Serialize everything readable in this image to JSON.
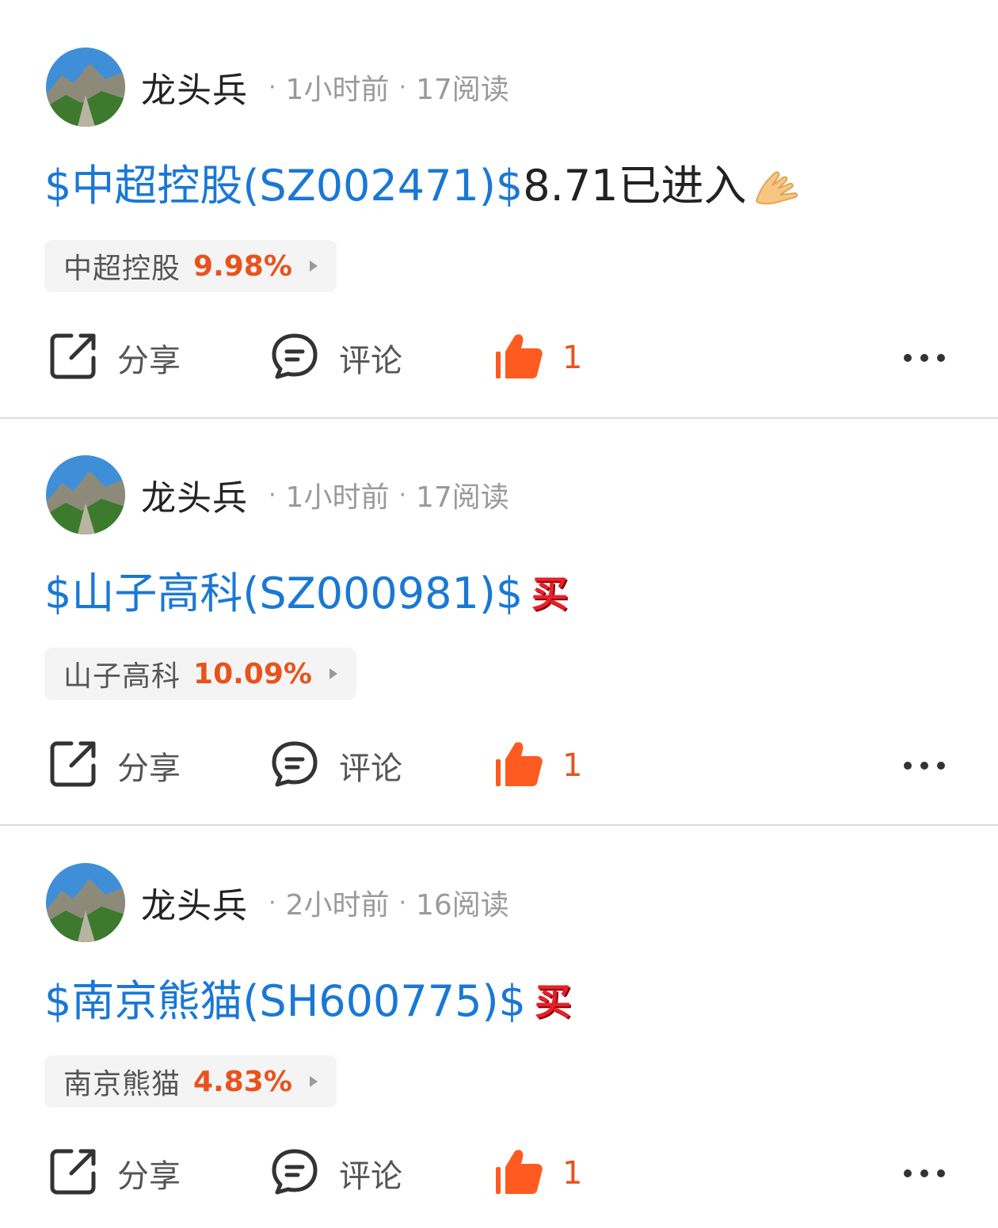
{
  "posts": [
    {
      "author": "龙头兵",
      "time": "1小时前",
      "reads": "17阅读",
      "link_text": "$中超控股(SZ002471)$",
      "extra_text": "8.71已进入",
      "emoji": "pray-hands-emoji",
      "tag_name": "中超控股",
      "tag_pct": "9.98%",
      "share_label": "分享",
      "comment_label": "评论",
      "like_count": "1"
    },
    {
      "author": "龙头兵",
      "time": "1小时前",
      "reads": "17阅读",
      "link_text": "$山子高科(SZ000981)$",
      "extra_text": "",
      "emoji": "buy-sticker-emoji",
      "emoji_text": "买",
      "tag_name": "山子高科",
      "tag_pct": "10.09%",
      "share_label": "分享",
      "comment_label": "评论",
      "like_count": "1"
    },
    {
      "author": "龙头兵",
      "time": "2小时前",
      "reads": "16阅读",
      "link_text": "$南京熊猫(SH600775)$",
      "extra_text": "",
      "emoji": "buy-sticker-emoji",
      "emoji_text": "买",
      "tag_name": "南京熊猫",
      "tag_pct": "4.83%",
      "share_label": "分享",
      "comment_label": "评论",
      "like_count": "1"
    }
  ],
  "colors": {
    "link": "#1a78d4",
    "accent": "#e8531c",
    "muted": "#9a9a9a"
  },
  "icons": [
    "share-icon",
    "comment-icon",
    "like-icon",
    "more-icon"
  ]
}
